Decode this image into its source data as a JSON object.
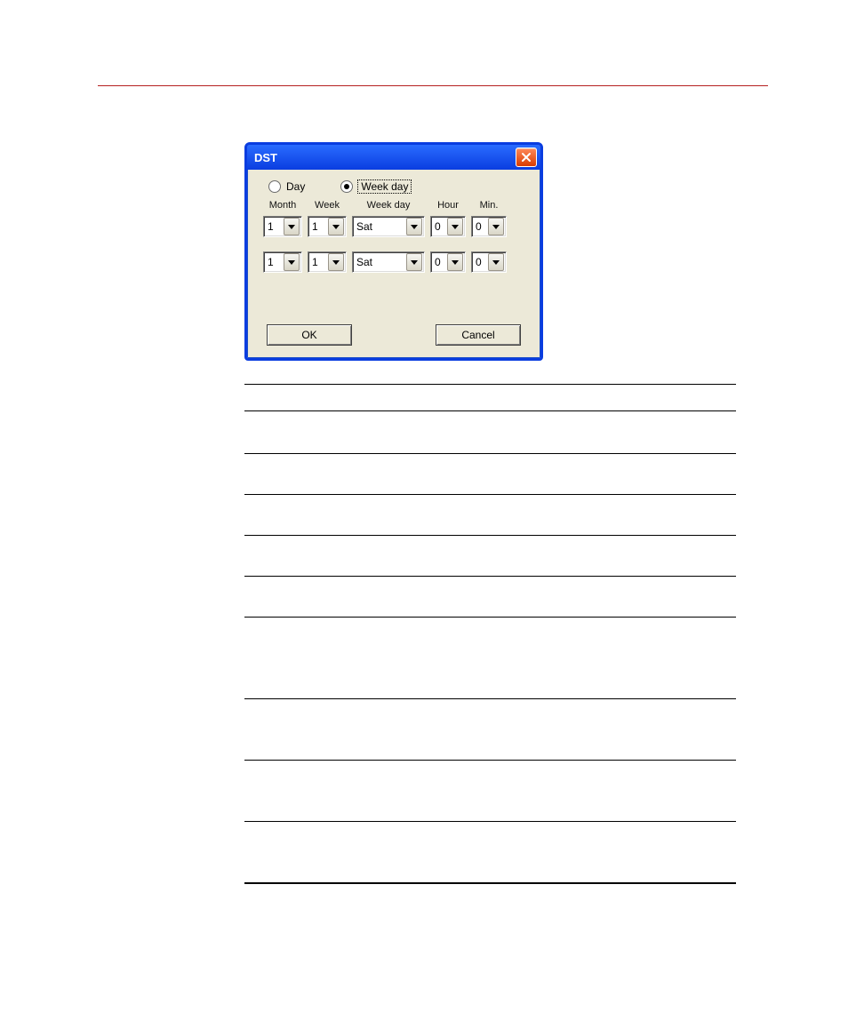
{
  "dialog": {
    "title": "DST",
    "close_label": "Close",
    "radio": {
      "day": {
        "label": "Day",
        "checked": false
      },
      "weekday": {
        "label": "Week day",
        "checked": true
      }
    },
    "headers": {
      "month": "Month",
      "week": "Week",
      "weekday": "Week day",
      "hour": "Hour",
      "min": "Min."
    },
    "rows": [
      {
        "month": "1",
        "week": "1",
        "weekday": "Sat",
        "hour": "0",
        "min": "0"
      },
      {
        "month": "1",
        "week": "1",
        "weekday": "Sat",
        "hour": "0",
        "min": "0"
      }
    ],
    "buttons": {
      "ok": "OK",
      "cancel": "Cancel"
    }
  },
  "lines": {
    "offsets": [
      0,
      29,
      76,
      121,
      166,
      211,
      256,
      347,
      415,
      483,
      551,
      551
    ]
  }
}
